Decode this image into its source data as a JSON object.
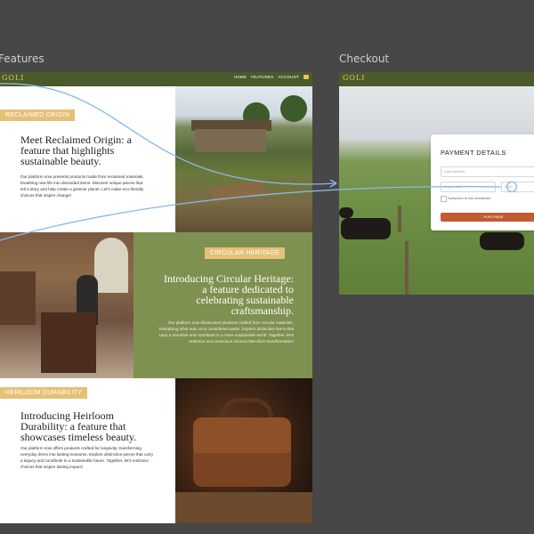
{
  "frames": {
    "features_label": "Features",
    "checkout_label": "Checkout"
  },
  "features": {
    "logo": "GOLI",
    "nav": {
      "home": "HOME",
      "features": "FEATURES",
      "account": "ACCOUNT"
    },
    "sections": [
      {
        "tag": "RECLAIMED ORIGIN",
        "heading": "Meet Reclaimed Origin: a feature that highlights sustainable beauty.",
        "body": "Our platform now presents products made from reclaimed materials, breathing new life into discarded items. Discover unique pieces that tell a story and help create a greener planet. Let's make eco-friendly choices that inspire change!"
      },
      {
        "tag": "CIRCULAR HERITAGE",
        "heading": "Introducing Circular Heritage: a feature dedicated to celebrating sustainable craftsmanship.",
        "body": "Our platform now showcases products crafted from circular materials, revitalizing what was once considered waste. Explore distinctive items that carry a narrative and contribute to a more sustainable world. Together, let's embrace eco-conscious choices that drive transformation!"
      },
      {
        "tag": "HEIRLOOM DURABILITY",
        "heading": "Introducing Heirloom Durability: a feature that showcases timeless beauty.",
        "body": "Our platform now offers products crafted for longevity, transforming everyday items into lasting treasures. Explore distinctive pieces that carry a legacy and contribute to a sustainable future. Together, let's embrace choices that inspire lasting impact!"
      }
    ]
  },
  "checkout": {
    "logo": "GOLI",
    "title": "PAYMENT DETAILS",
    "card_placeholder": "Card number",
    "expiry_placeholder": "Expiry date",
    "cvc_placeholder": "CVC",
    "subscribe_label": "Subscribe to the newsletter",
    "purchase_label": "PURCHASE"
  },
  "colors": {
    "canvas": "#474747",
    "nav": "#4a5a2a",
    "olive": "#7f9150",
    "tag": "#e7c077",
    "purchase": "#c25a32",
    "proto_line": "#8ab8e6"
  }
}
